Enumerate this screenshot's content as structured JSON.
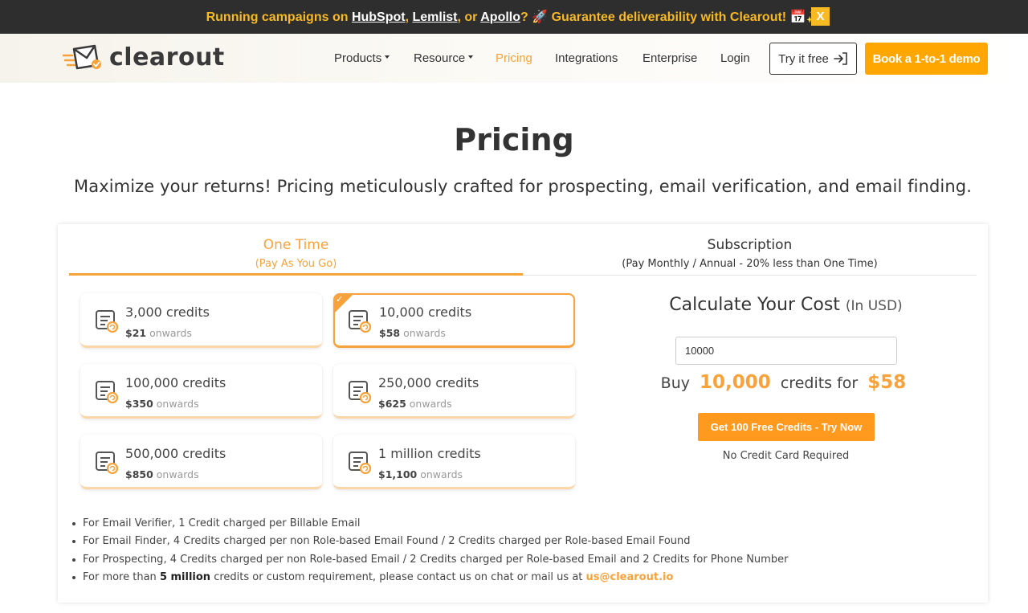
{
  "announcement": {
    "prefix": "Running campaigns on ",
    "hubspot": "HubSpot",
    "sep1": ", ",
    "lemlist": "Lemlist",
    "sep2": ", or ",
    "apollo": "Apollo",
    "suffix": "? 🚀 Guarantee deliverability with Clearout! 📅✨",
    "close_label": "X"
  },
  "nav": {
    "logo_text": "clearout",
    "items": [
      {
        "label": "Products",
        "has_caret": true
      },
      {
        "label": "Resource",
        "has_caret": true
      },
      {
        "label": "Pricing",
        "active": true
      },
      {
        "label": "Integrations"
      },
      {
        "label": "Enterprise"
      },
      {
        "label": "Login"
      }
    ],
    "try_label": "Try it free",
    "demo_label": "Book a 1-to-1 demo"
  },
  "header": {
    "title": "Pricing",
    "subtitle": "Maximize your returns! Pricing meticulously crafted for prospecting, email verification, and email finding."
  },
  "tabs": [
    {
      "title": "One Time",
      "subtitle": "(Pay As You Go)",
      "active": true
    },
    {
      "title": "Subscription",
      "subtitle": "(Pay Monthly / Annual - 20% less than One Time)",
      "active": false
    }
  ],
  "plans": [
    {
      "credits": "3,000 credits",
      "price": "$21",
      "onwards": "onwards"
    },
    {
      "credits": "10,000 credits",
      "price": "$58",
      "onwards": "onwards",
      "selected": true
    },
    {
      "credits": "100,000 credits",
      "price": "$350",
      "onwards": "onwards"
    },
    {
      "credits": "250,000 credits",
      "price": "$625",
      "onwards": "onwards"
    },
    {
      "credits": "500,000 credits",
      "price": "$850",
      "onwards": "onwards"
    },
    {
      "credits": "1 million credits",
      "price": "$1,100",
      "onwards": "onwards"
    }
  ],
  "calculator": {
    "title": "Calculate Your Cost",
    "unit": "(In USD)",
    "input_value": "10000",
    "buy_label": "Buy",
    "credits_amount": "10,000",
    "credits_for": "credits for",
    "cost": "$58",
    "cta_label": "Get 100 Free Credits - Try Now",
    "no_card": "No Credit Card Required"
  },
  "notes": {
    "items": [
      "For Email Verifier, 1 Credit charged per Billable Email",
      "For Email Finder, 4 Credits charged per non Role-based Email Found / 2 Credits charged per Role-based Email Found",
      "For Prospecting, 4 Credits charged per non Role-based Email / 2 Credits charged per Role-based Email and 2 Credits for Phone Number"
    ],
    "last_prefix": "For more than ",
    "last_bold": "5 million",
    "last_middle": " credits or custom requirement, please contact us on chat or mail us at ",
    "last_email": "us@clearout.io"
  },
  "colors": {
    "accent": "#f7a23b",
    "announce_bg": "#2e2e2e",
    "announce_text": "#f7b924",
    "demo_button": "#ffa600"
  }
}
